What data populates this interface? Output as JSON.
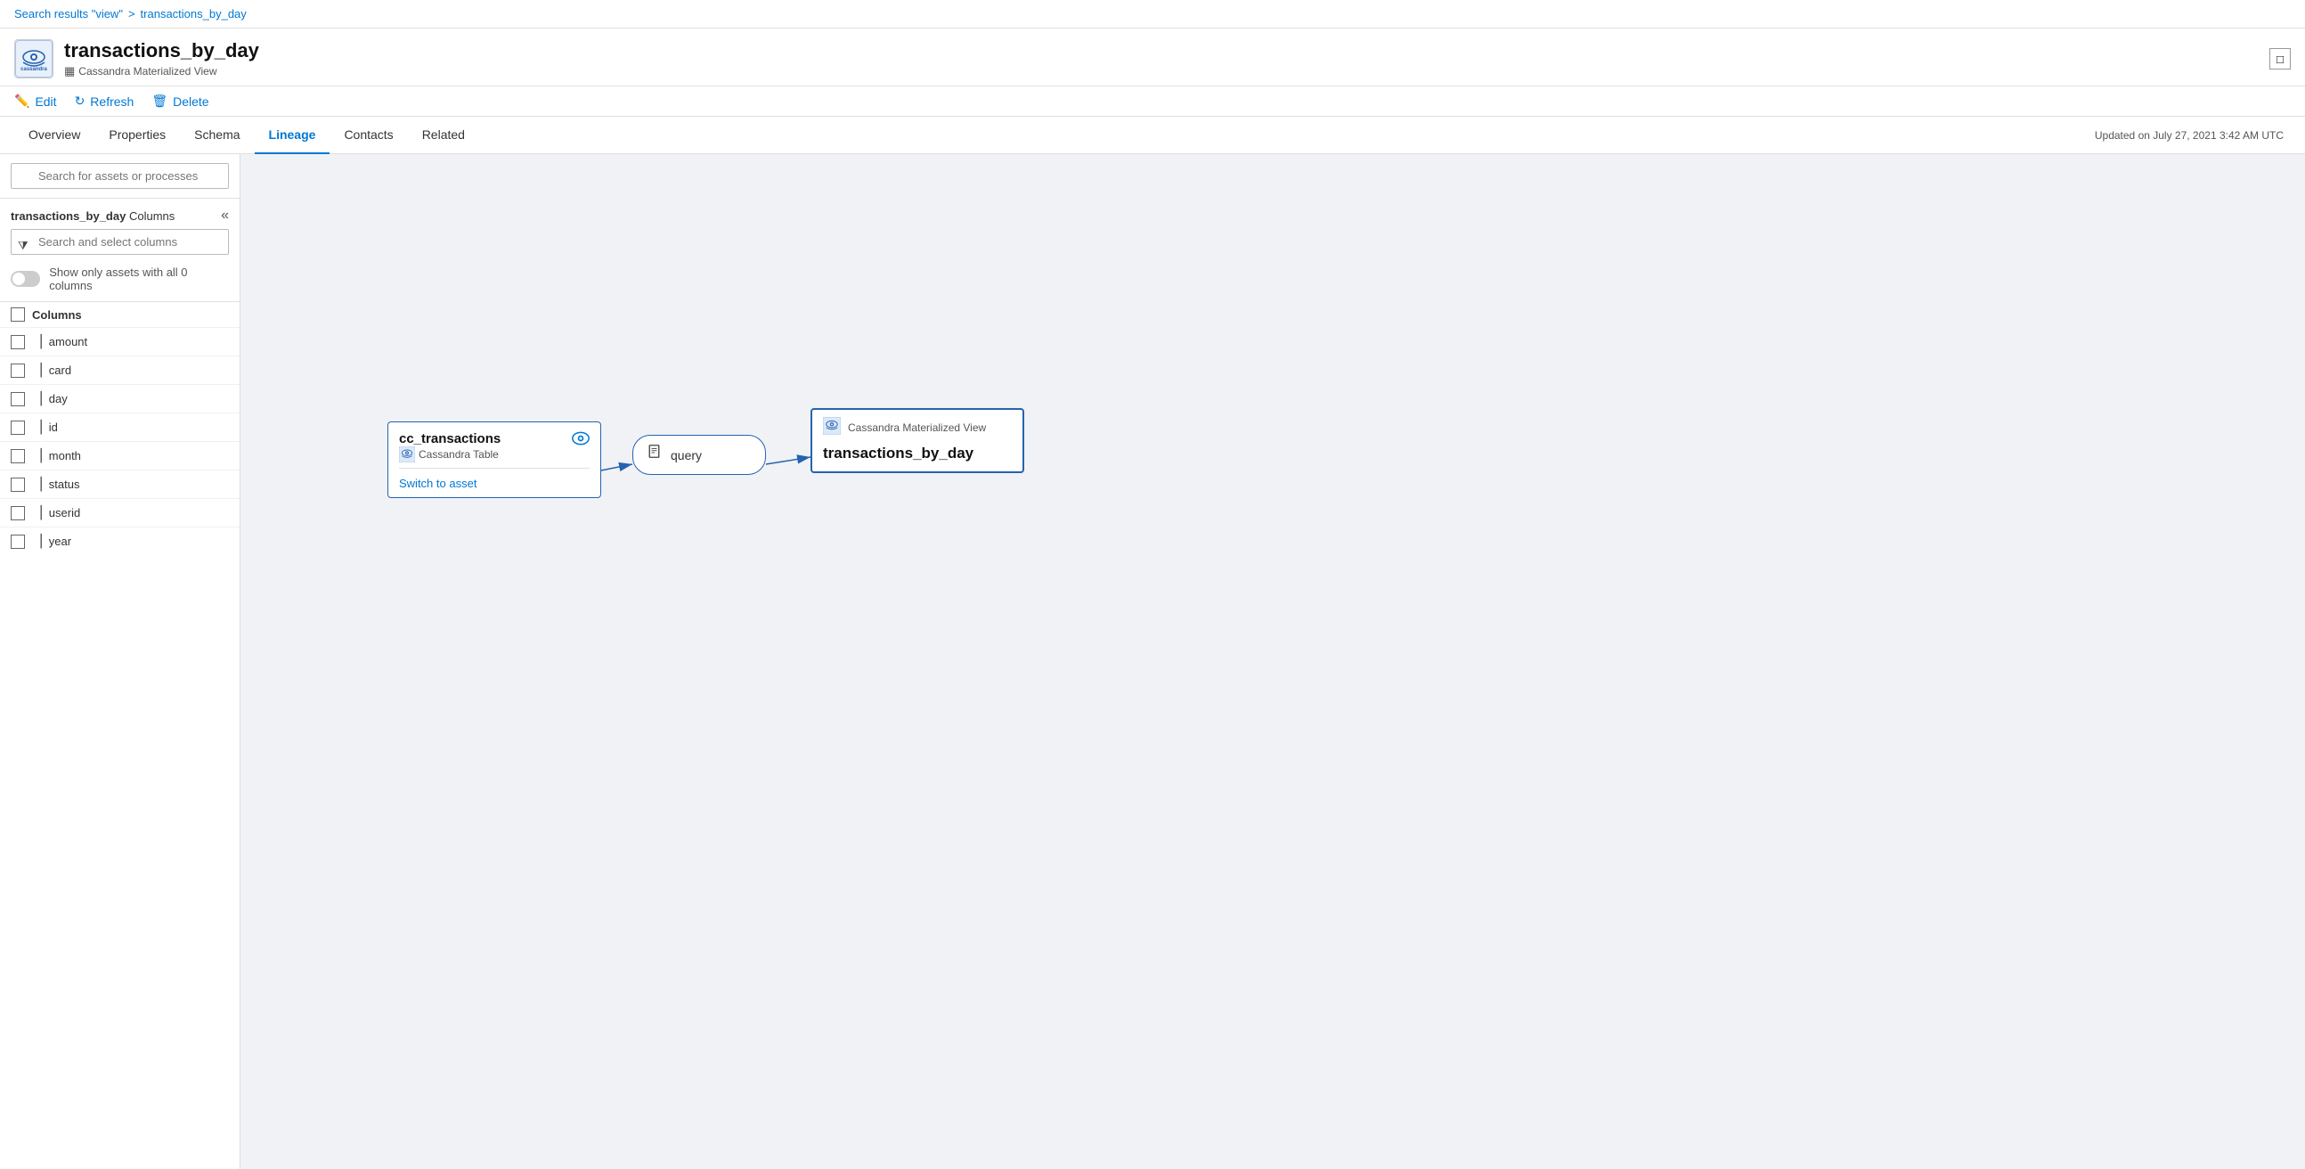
{
  "breadcrumb": {
    "search_link": "Search results \"view\"",
    "separator": ">",
    "current": "transactions_by_day"
  },
  "asset": {
    "title": "transactions_by_day",
    "subtitle": "Cassandra Materialized View",
    "updated_label": "Updated on July 27, 2021 3:42 AM UTC"
  },
  "toolbar": {
    "edit_label": "Edit",
    "refresh_label": "Refresh",
    "delete_label": "Delete"
  },
  "tabs": [
    {
      "id": "overview",
      "label": "Overview",
      "active": false
    },
    {
      "id": "properties",
      "label": "Properties",
      "active": false
    },
    {
      "id": "schema",
      "label": "Schema",
      "active": false
    },
    {
      "id": "lineage",
      "label": "Lineage",
      "active": true
    },
    {
      "id": "contacts",
      "label": "Contacts",
      "active": false
    },
    {
      "id": "related",
      "label": "Related",
      "active": false
    }
  ],
  "search_bar": {
    "placeholder": "Search for assets or processes"
  },
  "left_panel": {
    "title_bold": "transactions_by_day",
    "title_normal": " Columns",
    "column_search_placeholder": "Search and select columns",
    "toggle_label": "Show only assets with all 0 columns",
    "columns_header": "Columns",
    "columns": [
      {
        "name": "amount"
      },
      {
        "name": "card"
      },
      {
        "name": "day"
      },
      {
        "name": "id"
      },
      {
        "name": "month"
      },
      {
        "name": "status"
      },
      {
        "name": "userid"
      },
      {
        "name": "year"
      }
    ]
  },
  "lineage": {
    "source_node": {
      "title": "cc_transactions",
      "subtitle": "Cassandra Table",
      "link": "Switch to asset"
    },
    "process_node": {
      "label": "query"
    },
    "target_node": {
      "type_label": "Cassandra Materialized View",
      "name": "transactions_by_day"
    }
  },
  "icons": {
    "edit": "✏",
    "refresh": "↻",
    "delete": "🗑",
    "search": "🔍",
    "filter": "⧩",
    "collapse": "«",
    "checkbox_empty": "",
    "column_item": "▏",
    "eye": "👁",
    "doc": "📄",
    "cassandra_abbr": "C"
  }
}
